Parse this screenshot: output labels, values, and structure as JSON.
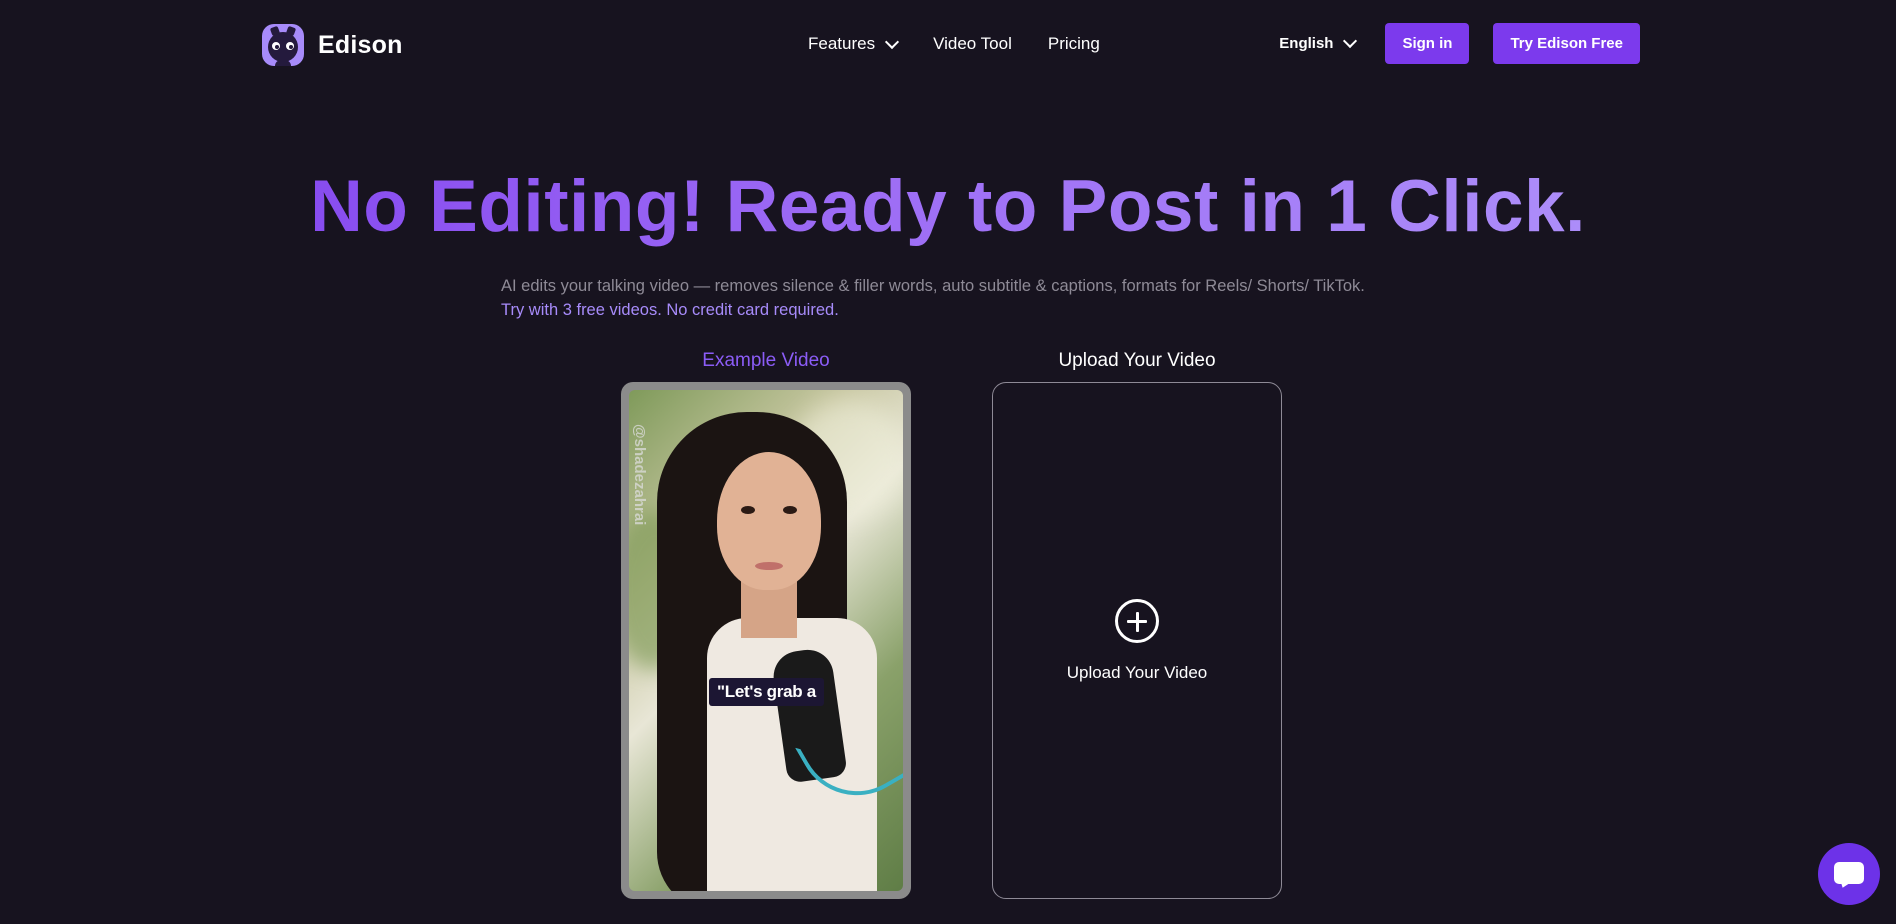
{
  "brand": {
    "name": "Edison"
  },
  "nav": {
    "items": [
      {
        "label": "Features",
        "has_dropdown": true
      },
      {
        "label": "Video Tool",
        "has_dropdown": false
      },
      {
        "label": "Pricing",
        "has_dropdown": false
      }
    ],
    "language": "English",
    "sign_in": "Sign in",
    "cta": "Try Edison Free"
  },
  "hero": {
    "title": "No Editing! Ready to Post in 1 Click.",
    "subtitle": "AI edits your talking video — removes silence & filler words, auto subtitle & captions, formats for Reels/ Shorts/ TikTok.",
    "free_note": "Try with 3 free videos. No credit card required."
  },
  "example": {
    "label": "Example Video",
    "watermark": "@shadezahrai",
    "caption": "\"Let's grab a"
  },
  "upload": {
    "label": "Upload Your Video",
    "button_text": "Upload Your Video"
  },
  "colors": {
    "background": "#17131f",
    "accent": "#7c3aed",
    "accent_light": "#a78bfa",
    "muted_text": "#8e8a96"
  },
  "icons": [
    "logo-owl-icon",
    "chevron-down-icon",
    "plus-circle-icon",
    "chat-icon"
  ]
}
